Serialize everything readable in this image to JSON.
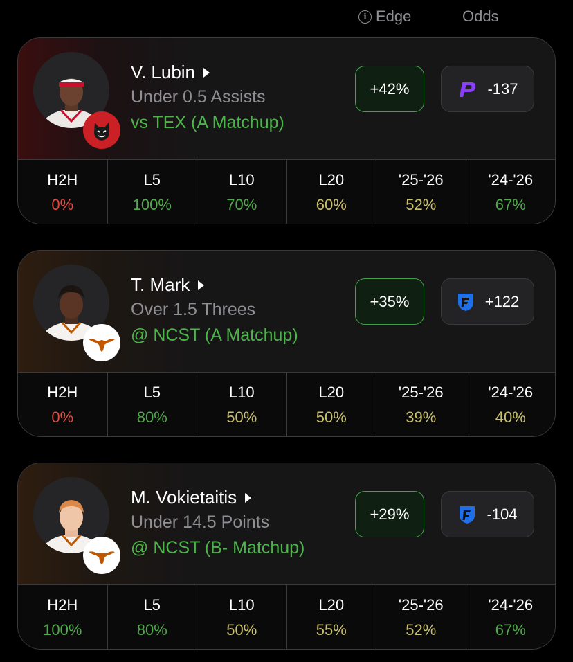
{
  "header": {
    "edge_label": "Edge",
    "odds_label": "Odds",
    "info_glyph": "i"
  },
  "cards": [
    {
      "player": "V. Lubin",
      "prop": "Under 0.5 Assists",
      "matchup": "vs TEX (A Matchup)",
      "edge": "+42%",
      "odds": "-137",
      "book_icon": "prizepicks-icon",
      "team_logo": "nc-state-wolfpack-logo",
      "stats": [
        {
          "label": "H2H",
          "value": "0%",
          "color": "red"
        },
        {
          "label": "L5",
          "value": "100%",
          "color": "green"
        },
        {
          "label": "L10",
          "value": "70%",
          "color": "green"
        },
        {
          "label": "L20",
          "value": "60%",
          "color": "yellow"
        },
        {
          "label": "'25-'26",
          "value": "52%",
          "color": "yellow"
        },
        {
          "label": "'24-'26",
          "value": "67%",
          "color": "green"
        }
      ]
    },
    {
      "player": "T. Mark",
      "prop": "Over 1.5 Threes",
      "matchup": "@ NCST (A Matchup)",
      "edge": "+35%",
      "odds": "+122",
      "book_icon": "fanduel-icon",
      "team_logo": "texas-longhorns-logo",
      "stats": [
        {
          "label": "H2H",
          "value": "0%",
          "color": "red"
        },
        {
          "label": "L5",
          "value": "80%",
          "color": "green"
        },
        {
          "label": "L10",
          "value": "50%",
          "color": "yellow"
        },
        {
          "label": "L20",
          "value": "50%",
          "color": "yellow"
        },
        {
          "label": "'25-'26",
          "value": "39%",
          "color": "yellow"
        },
        {
          "label": "'24-'26",
          "value": "40%",
          "color": "yellow"
        }
      ]
    },
    {
      "player": "M. Vokietaitis",
      "prop": "Under 14.5 Points",
      "matchup": "@ NCST (B- Matchup)",
      "edge": "+29%",
      "odds": "-104",
      "book_icon": "fanduel-icon",
      "team_logo": "texas-longhorns-logo",
      "stats": [
        {
          "label": "H2H",
          "value": "100%",
          "color": "green"
        },
        {
          "label": "L5",
          "value": "80%",
          "color": "green"
        },
        {
          "label": "L10",
          "value": "50%",
          "color": "yellow"
        },
        {
          "label": "L20",
          "value": "55%",
          "color": "yellow"
        },
        {
          "label": "'25-'26",
          "value": "52%",
          "color": "yellow"
        },
        {
          "label": "'24-'26",
          "value": "67%",
          "color": "green"
        }
      ]
    }
  ],
  "colors": {
    "red": "#e04b43",
    "green": "#52a84c",
    "yellow": "#c9c06a",
    "matchup": "#4cb54a",
    "edge_border": "#3fa34a"
  }
}
